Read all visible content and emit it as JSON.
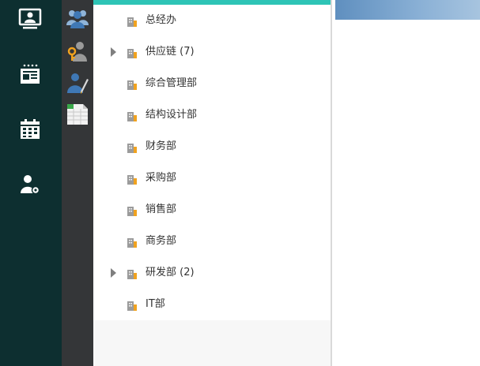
{
  "nav_rail": {
    "items": [
      {
        "icon": "monitor-user-icon"
      },
      {
        "icon": "newspaper-icon"
      },
      {
        "icon": "calendar-icon"
      },
      {
        "icon": "user-settings-icon"
      }
    ]
  },
  "sub_rail": {
    "items": [
      {
        "icon": "users-group-icon"
      },
      {
        "icon": "user-key-icon"
      },
      {
        "icon": "user-edit-icon"
      },
      {
        "icon": "spreadsheet-icon"
      }
    ]
  },
  "tree": {
    "items": [
      {
        "label": "总经办",
        "expandable": false
      },
      {
        "label": "供应链 (7)",
        "expandable": true
      },
      {
        "label": "综合管理部",
        "expandable": false
      },
      {
        "label": "结构设计部",
        "expandable": false
      },
      {
        "label": "财务部",
        "expandable": false
      },
      {
        "label": "采购部",
        "expandable": false
      },
      {
        "label": "销售部",
        "expandable": false
      },
      {
        "label": "商务部",
        "expandable": false
      },
      {
        "label": "研发部 (2)",
        "expandable": true
      },
      {
        "label": "IT部",
        "expandable": false
      }
    ]
  },
  "colors": {
    "accent": "#2ec4b6",
    "nav_bg": "#0d2f30",
    "sub_rail_bg": "#343638",
    "header_blue": "#7aa6d0"
  }
}
